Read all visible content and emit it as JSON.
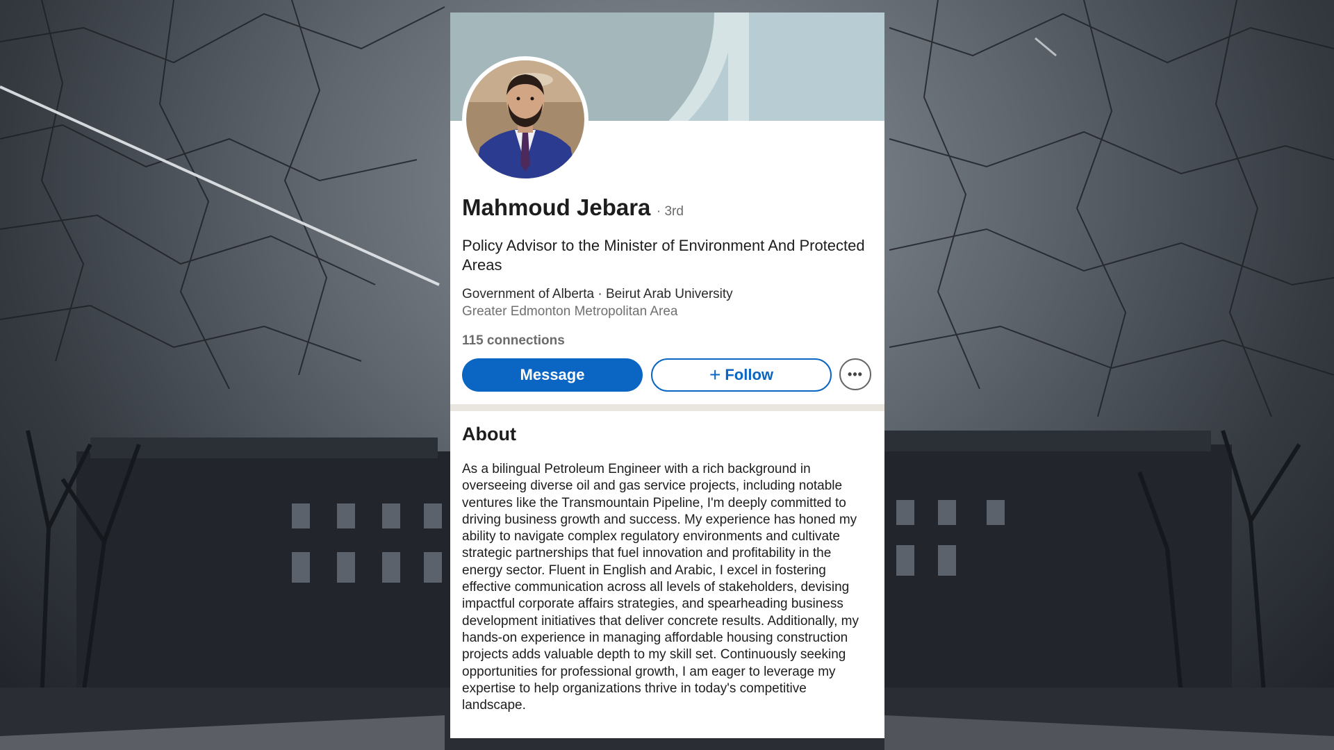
{
  "profile": {
    "name": "Mahmoud Jebara",
    "degree": "· 3rd",
    "headline": "Policy Advisor to the Minister of Environment And Protected Areas",
    "orgs": "Government of Alberta · Beirut Arab University",
    "location": "Greater Edmonton Metropolitan Area",
    "connections": "115 connections"
  },
  "actions": {
    "message_label": "Message",
    "follow_icon": "plus-icon",
    "follow_label": "Follow",
    "more_icon": "more-icon"
  },
  "about": {
    "title": "About",
    "text": "As a bilingual Petroleum Engineer with a rich background in overseeing diverse oil and gas service projects, including notable ventures like the Transmountain Pipeline, I'm deeply committed to driving business growth and success. My experience has honed my ability to navigate complex regulatory environments and cultivate strategic partnerships that fuel innovation and profitability in the energy sector. Fluent in English and Arabic, I excel in fostering effective communication across all levels of stakeholders, devising impactful corporate affairs strategies, and spearheading business development initiatives that deliver concrete results. Additionally, my hands-on experience in managing affordable housing construction projects adds valuable depth to my skill set. Continuously seeking opportunities for professional growth, I am eager to leverage my expertise to help organizations thrive in today's competitive landscape."
  },
  "colors": {
    "brand_blue": "#0a66c2",
    "banner": "#b7cdd3",
    "divider": "#e9e6df"
  }
}
